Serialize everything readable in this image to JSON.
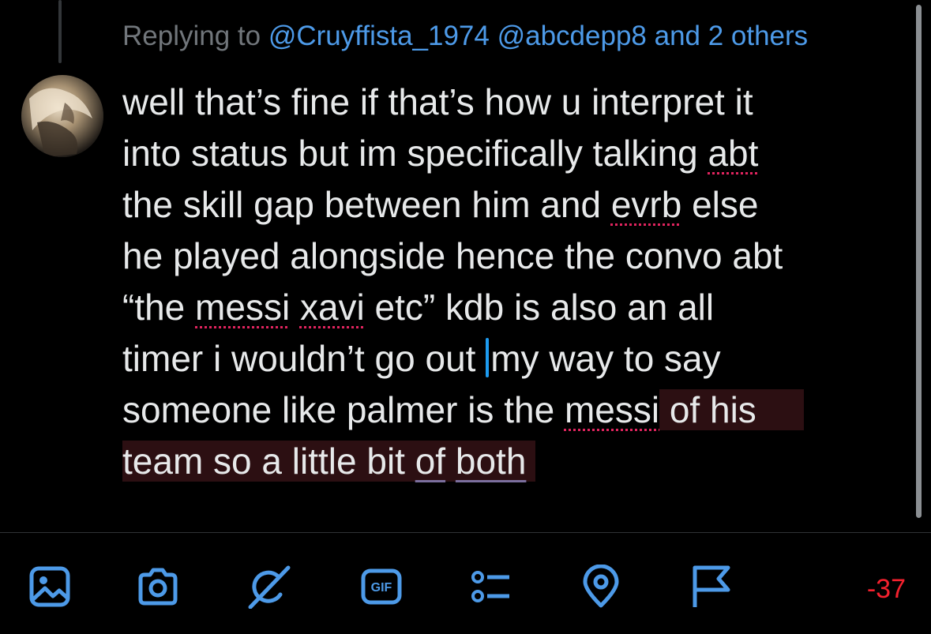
{
  "reply_header": {
    "prefix": "Replying to ",
    "mentions": "@Cruyffista_1974 @abcdepp8 and 2 others"
  },
  "compose": {
    "l1": "well that’s fine if that’s how u interpret it",
    "l2a": "into status but im specifically talking ",
    "l2b": "abt",
    "l3a": "the skill gap between him and ",
    "l3b": "evrb",
    "l3c": " else",
    "l4": "he played alongside hence the convo abt",
    "l5a": "“the ",
    "l5b": "messi",
    "l5c": " ",
    "l5d": "xavi",
    "l5e": " etc” kdb is also an all",
    "l6a": "timer i wouldn’t go out ",
    "l6b": "my way to say",
    "l7a": "someone like palmer is the ",
    "l7b": "messi",
    "l7c": " of his",
    "l8a": "team so a little bit ",
    "l8b": "of",
    "l8c": " ",
    "l8d": "both"
  },
  "toolbar": {
    "icons": [
      "image-icon",
      "camera-icon",
      "grok-icon",
      "gif-icon",
      "poll-icon",
      "location-icon",
      "flag-icon"
    ],
    "gif_label": "GIF",
    "char_count": "-37"
  },
  "colors": {
    "background": "#000000",
    "accent": "#4d9ae8",
    "text": "#e7e9ea",
    "muted": "#71767b",
    "over_limit": "#f4212e",
    "over_limit_highlight": "#2c0f12"
  }
}
